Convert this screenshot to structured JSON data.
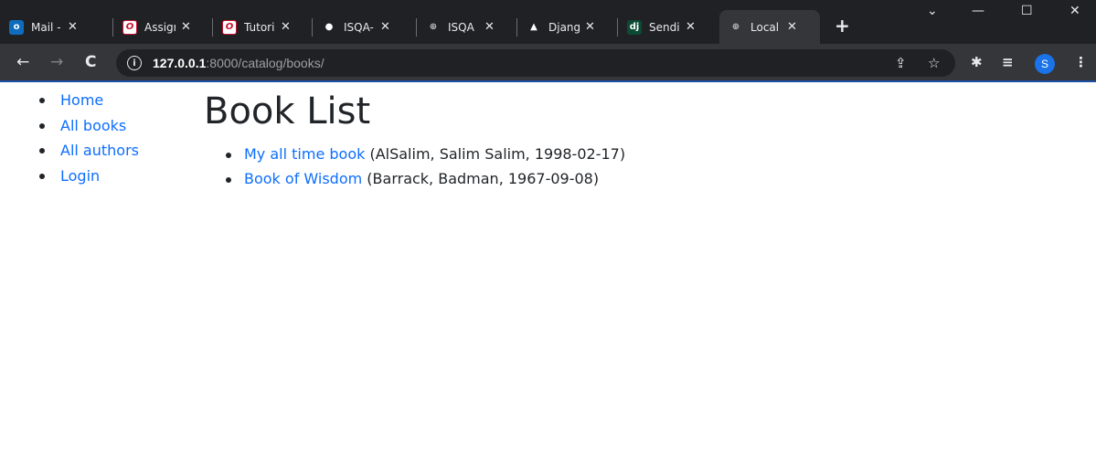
{
  "browser": {
    "tabs": [
      {
        "title": "Mail -",
        "icon": "outlook-icon",
        "fav": "o"
      },
      {
        "title": "Assigr",
        "icon": "unl-icon",
        "fav": "O"
      },
      {
        "title": "Tutori",
        "icon": "unl-icon",
        "fav": "O"
      },
      {
        "title": "ISQA-",
        "icon": "github-icon",
        "fav": "●"
      },
      {
        "title": "ISQA",
        "icon": "globe-icon",
        "fav": "⊕"
      },
      {
        "title": "Djang",
        "icon": "django-icon",
        "fav": "▲"
      },
      {
        "title": "Sendi",
        "icon": "dj-icon",
        "fav": "dj"
      },
      {
        "title": "Local",
        "icon": "globe-icon",
        "fav": "⊕",
        "active": true
      }
    ],
    "close_glyph": "✕",
    "new_tab_glyph": "+",
    "window_controls": {
      "dropdown": "⌄",
      "minimize": "—",
      "maximize": "☐",
      "close": "✕"
    },
    "nav": {
      "back": "←",
      "forward": "→",
      "reload": "C"
    },
    "address": {
      "host": "127.0.0.1",
      "path": ":8000/catalog/books/"
    },
    "icons": {
      "share": "⇪",
      "bookmark": "☆",
      "extensions": "✱",
      "reading_list": "≡",
      "menu": "⋮"
    },
    "profile_initial": "S"
  },
  "sidebar": {
    "items": [
      {
        "label": "Home"
      },
      {
        "label": "All books"
      },
      {
        "label": "All authors"
      },
      {
        "label": "Login"
      }
    ]
  },
  "main": {
    "title": "Book List",
    "books": [
      {
        "title": "My all time book",
        "details": " (AlSalim, Salim Salim, 1998-02-17)"
      },
      {
        "title": "Book of Wisdom",
        "details": " (Barrack, Badman, 1967-09-08)"
      }
    ]
  },
  "colors": {
    "link": "#0d6efd",
    "text": "#212529",
    "chrome_dark": "#202124",
    "chrome_toolbar": "#35363a"
  }
}
